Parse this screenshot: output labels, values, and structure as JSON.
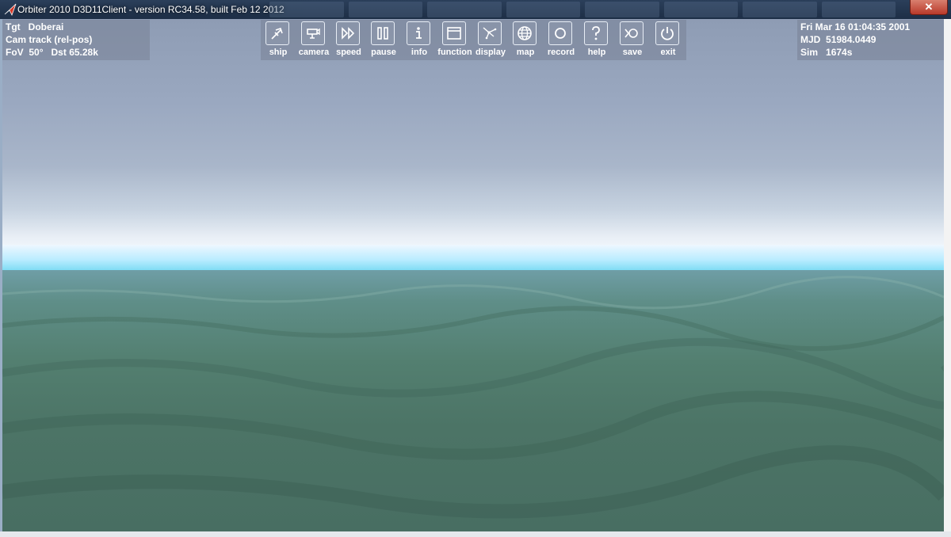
{
  "window": {
    "title": "Orbiter 2010 D3D11Client - version RC34.58, built Feb 12 2012",
    "close_glyph": "✕"
  },
  "hud_left": {
    "rows": [
      {
        "label": "Tgt",
        "value": "Doberai"
      },
      {
        "label": "Cam",
        "value": "track (rel-pos)"
      },
      {
        "label": "FoV",
        "value": "50°",
        "label2": "Dst",
        "value2": "65.28k"
      }
    ]
  },
  "hud_right": {
    "date": "Fri Mar 16 01:04:35 2001",
    "mjd_label": "MJD",
    "mjd_value": "51984.0449",
    "sim_label": "Sim",
    "sim_value": "1674s"
  },
  "toolbar": {
    "items": [
      {
        "label": "ship",
        "icon": "ship-icon"
      },
      {
        "label": "camera",
        "icon": "camera-icon"
      },
      {
        "label": "speed",
        "icon": "speed-icon"
      },
      {
        "label": "pause",
        "icon": "pause-icon"
      },
      {
        "label": "info",
        "icon": "info-icon"
      },
      {
        "label": "function",
        "icon": "function-icon"
      },
      {
        "label": "display",
        "icon": "display-icon"
      },
      {
        "label": "map",
        "icon": "map-icon"
      },
      {
        "label": "record",
        "icon": "record-icon"
      },
      {
        "label": "help",
        "icon": "help-icon"
      },
      {
        "label": "save",
        "icon": "save-icon"
      },
      {
        "label": "exit",
        "icon": "exit-icon"
      }
    ]
  },
  "colors": {
    "hud_panel": "#7882968c",
    "sky_top": "#8e9cb4",
    "horizon_haze": "#73d9f2",
    "terrain": "#4c7466"
  }
}
